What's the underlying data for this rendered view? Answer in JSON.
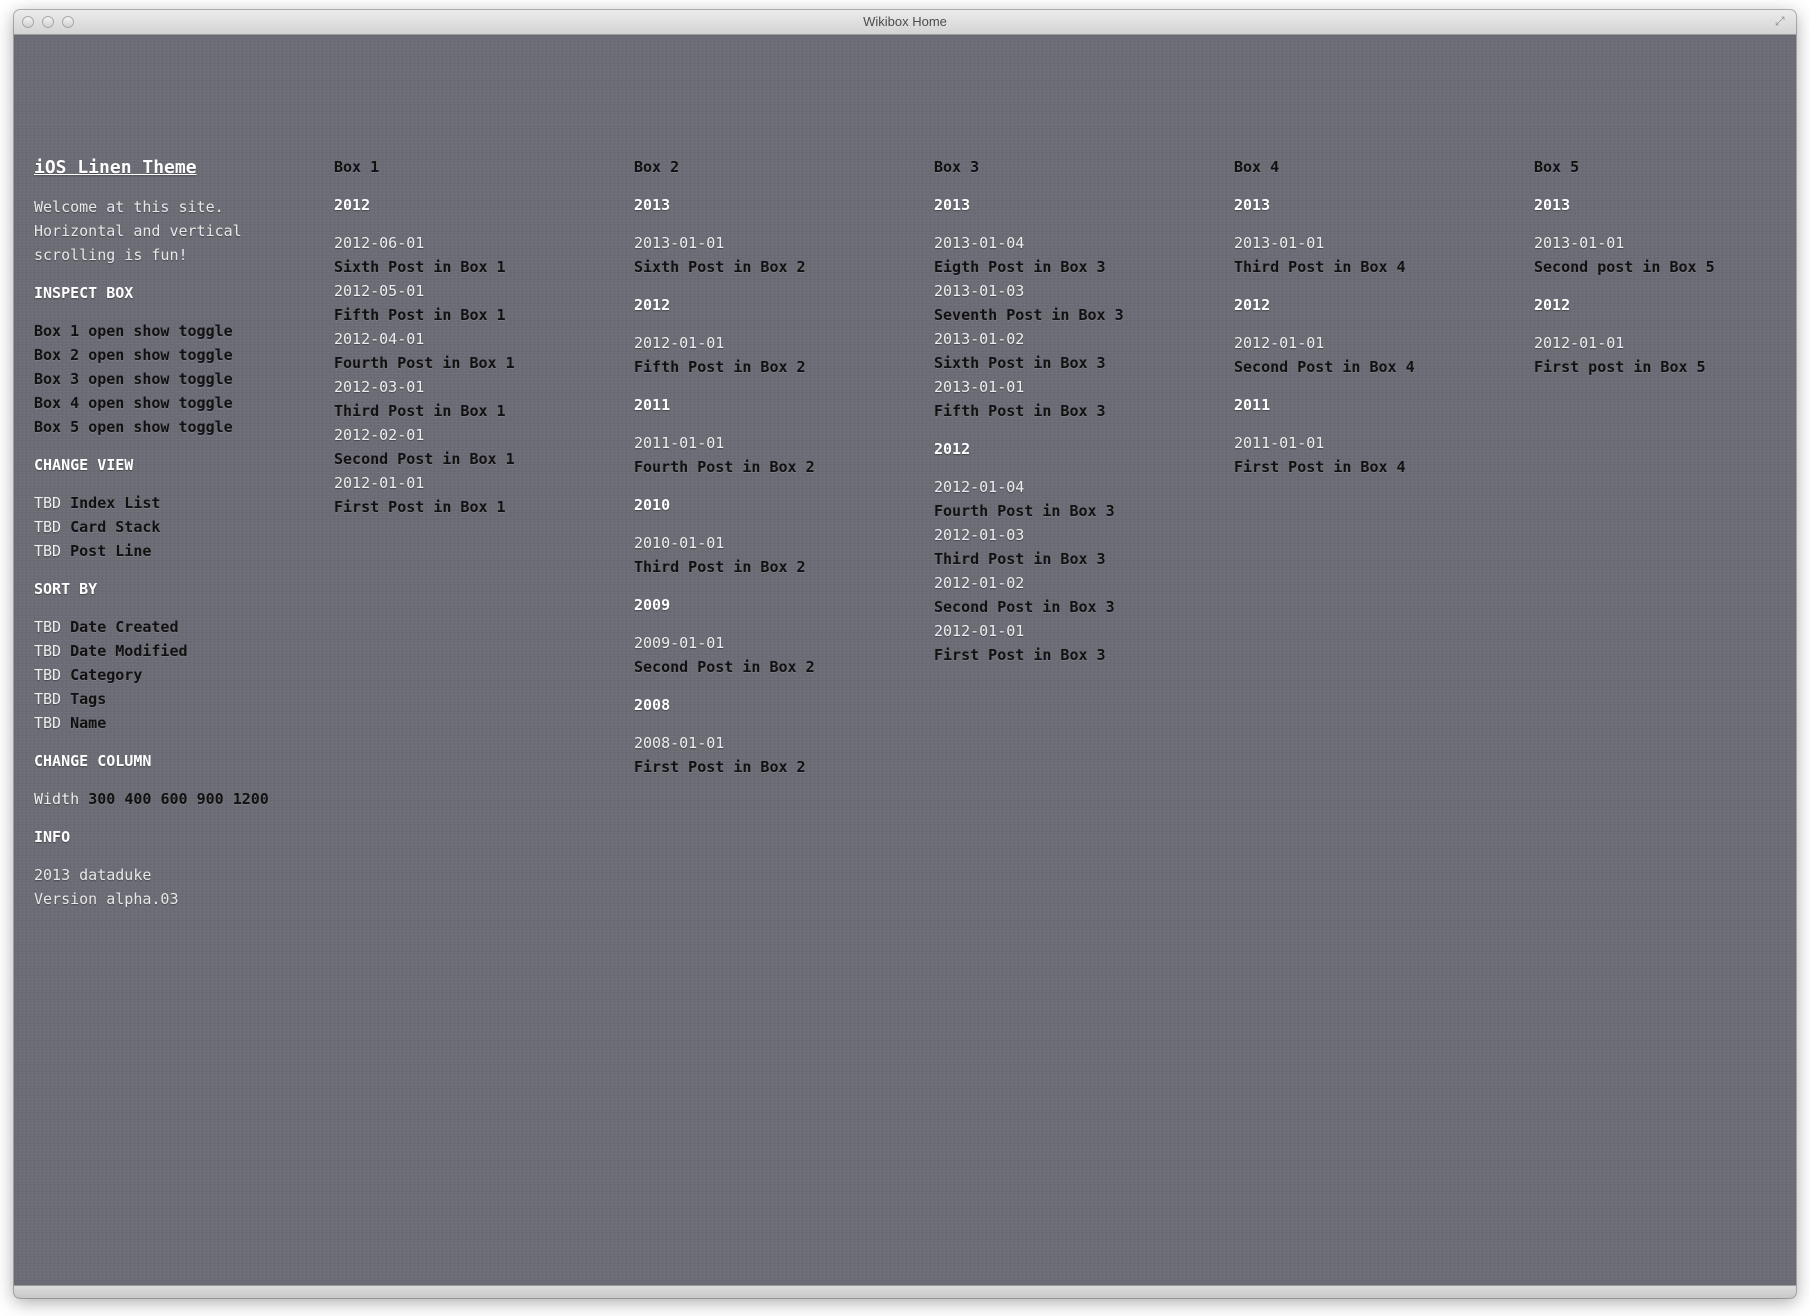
{
  "window": {
    "title": "Wikibox Home"
  },
  "sidebar": {
    "site_title": "iOS Linen Theme",
    "intro_lines": [
      "Welcome at this site.",
      "Horizontal and vertical",
      "scrolling is fun!"
    ],
    "inspect": {
      "heading": "INSPECT BOX",
      "rows": [
        {
          "box": "Box 1",
          "actions": "open show toggle"
        },
        {
          "box": "Box 2",
          "actions": "open show toggle"
        },
        {
          "box": "Box 3",
          "actions": "open show toggle"
        },
        {
          "box": "Box 4",
          "actions": "open show toggle"
        },
        {
          "box": "Box 5",
          "actions": "open show toggle"
        }
      ]
    },
    "change_view": {
      "heading": "CHANGE VIEW",
      "rows": [
        {
          "prefix": "TBD",
          "label": "Index List"
        },
        {
          "prefix": "TBD",
          "label": "Card Stack"
        },
        {
          "prefix": "TBD",
          "label": "Post Line"
        }
      ]
    },
    "sort_by": {
      "heading": "SORT BY",
      "rows": [
        {
          "prefix": "TBD",
          "label": "Date Created"
        },
        {
          "prefix": "TBD",
          "label": "Date Modified"
        },
        {
          "prefix": "TBD",
          "label": "Category"
        },
        {
          "prefix": "TBD",
          "label": "Tags"
        },
        {
          "prefix": "TBD",
          "label": "Name"
        }
      ]
    },
    "change_column": {
      "heading": "CHANGE COLUMN",
      "prefix": "Width",
      "options": [
        "300",
        "400",
        "600",
        "900",
        "1200"
      ]
    },
    "info": {
      "heading": "INFO",
      "lines": [
        "2013 dataduke",
        "Version alpha.03"
      ]
    }
  },
  "boxes": [
    {
      "title": "Box 1",
      "years": [
        {
          "year": "2012",
          "posts": [
            {
              "date": "2012-06-01",
              "title": "Sixth Post in Box 1"
            },
            {
              "date": "2012-05-01",
              "title": "Fifth Post in Box 1"
            },
            {
              "date": "2012-04-01",
              "title": "Fourth Post in Box 1"
            },
            {
              "date": "2012-03-01",
              "title": "Third Post in Box 1"
            },
            {
              "date": "2012-02-01",
              "title": "Second Post in Box 1"
            },
            {
              "date": "2012-01-01",
              "title": "First Post in Box 1"
            }
          ]
        }
      ]
    },
    {
      "title": "Box 2",
      "years": [
        {
          "year": "2013",
          "posts": [
            {
              "date": "2013-01-01",
              "title": "Sixth Post in Box 2"
            }
          ]
        },
        {
          "year": "2012",
          "posts": [
            {
              "date": "2012-01-01",
              "title": "Fifth Post in Box 2"
            }
          ]
        },
        {
          "year": "2011",
          "posts": [
            {
              "date": "2011-01-01",
              "title": "Fourth Post in Box 2"
            }
          ]
        },
        {
          "year": "2010",
          "posts": [
            {
              "date": "2010-01-01",
              "title": "Third Post in Box 2"
            }
          ]
        },
        {
          "year": "2009",
          "posts": [
            {
              "date": "2009-01-01",
              "title": "Second Post in Box 2"
            }
          ]
        },
        {
          "year": "2008",
          "posts": [
            {
              "date": "2008-01-01",
              "title": "First Post in Box 2"
            }
          ]
        }
      ]
    },
    {
      "title": "Box 3",
      "years": [
        {
          "year": "2013",
          "posts": [
            {
              "date": "2013-01-04",
              "title": "Eigth Post in Box 3"
            },
            {
              "date": "2013-01-03",
              "title": "Seventh Post in Box 3"
            },
            {
              "date": "2013-01-02",
              "title": "Sixth Post in Box 3"
            },
            {
              "date": "2013-01-01",
              "title": "Fifth Post in Box 3"
            }
          ]
        },
        {
          "year": "2012",
          "posts": [
            {
              "date": "2012-01-04",
              "title": "Fourth Post in Box 3"
            },
            {
              "date": "2012-01-03",
              "title": "Third Post in Box 3"
            },
            {
              "date": "2012-01-02",
              "title": "Second Post in Box 3"
            },
            {
              "date": "2012-01-01",
              "title": "First Post in Box 3"
            }
          ]
        }
      ]
    },
    {
      "title": "Box 4",
      "years": [
        {
          "year": "2013",
          "posts": [
            {
              "date": "2013-01-01",
              "title": "Third Post in Box 4"
            }
          ]
        },
        {
          "year": "2012",
          "posts": [
            {
              "date": "2012-01-01",
              "title": "Second Post in Box 4"
            }
          ]
        },
        {
          "year": "2011",
          "posts": [
            {
              "date": "2011-01-01",
              "title": "First Post in Box 4"
            }
          ]
        }
      ]
    },
    {
      "title": "Box 5",
      "years": [
        {
          "year": "2013",
          "posts": [
            {
              "date": "2013-01-01",
              "title": "Second post in Box 5"
            }
          ]
        },
        {
          "year": "2012",
          "posts": [
            {
              "date": "2012-01-01",
              "title": "First post in Box 5"
            }
          ]
        }
      ]
    }
  ]
}
